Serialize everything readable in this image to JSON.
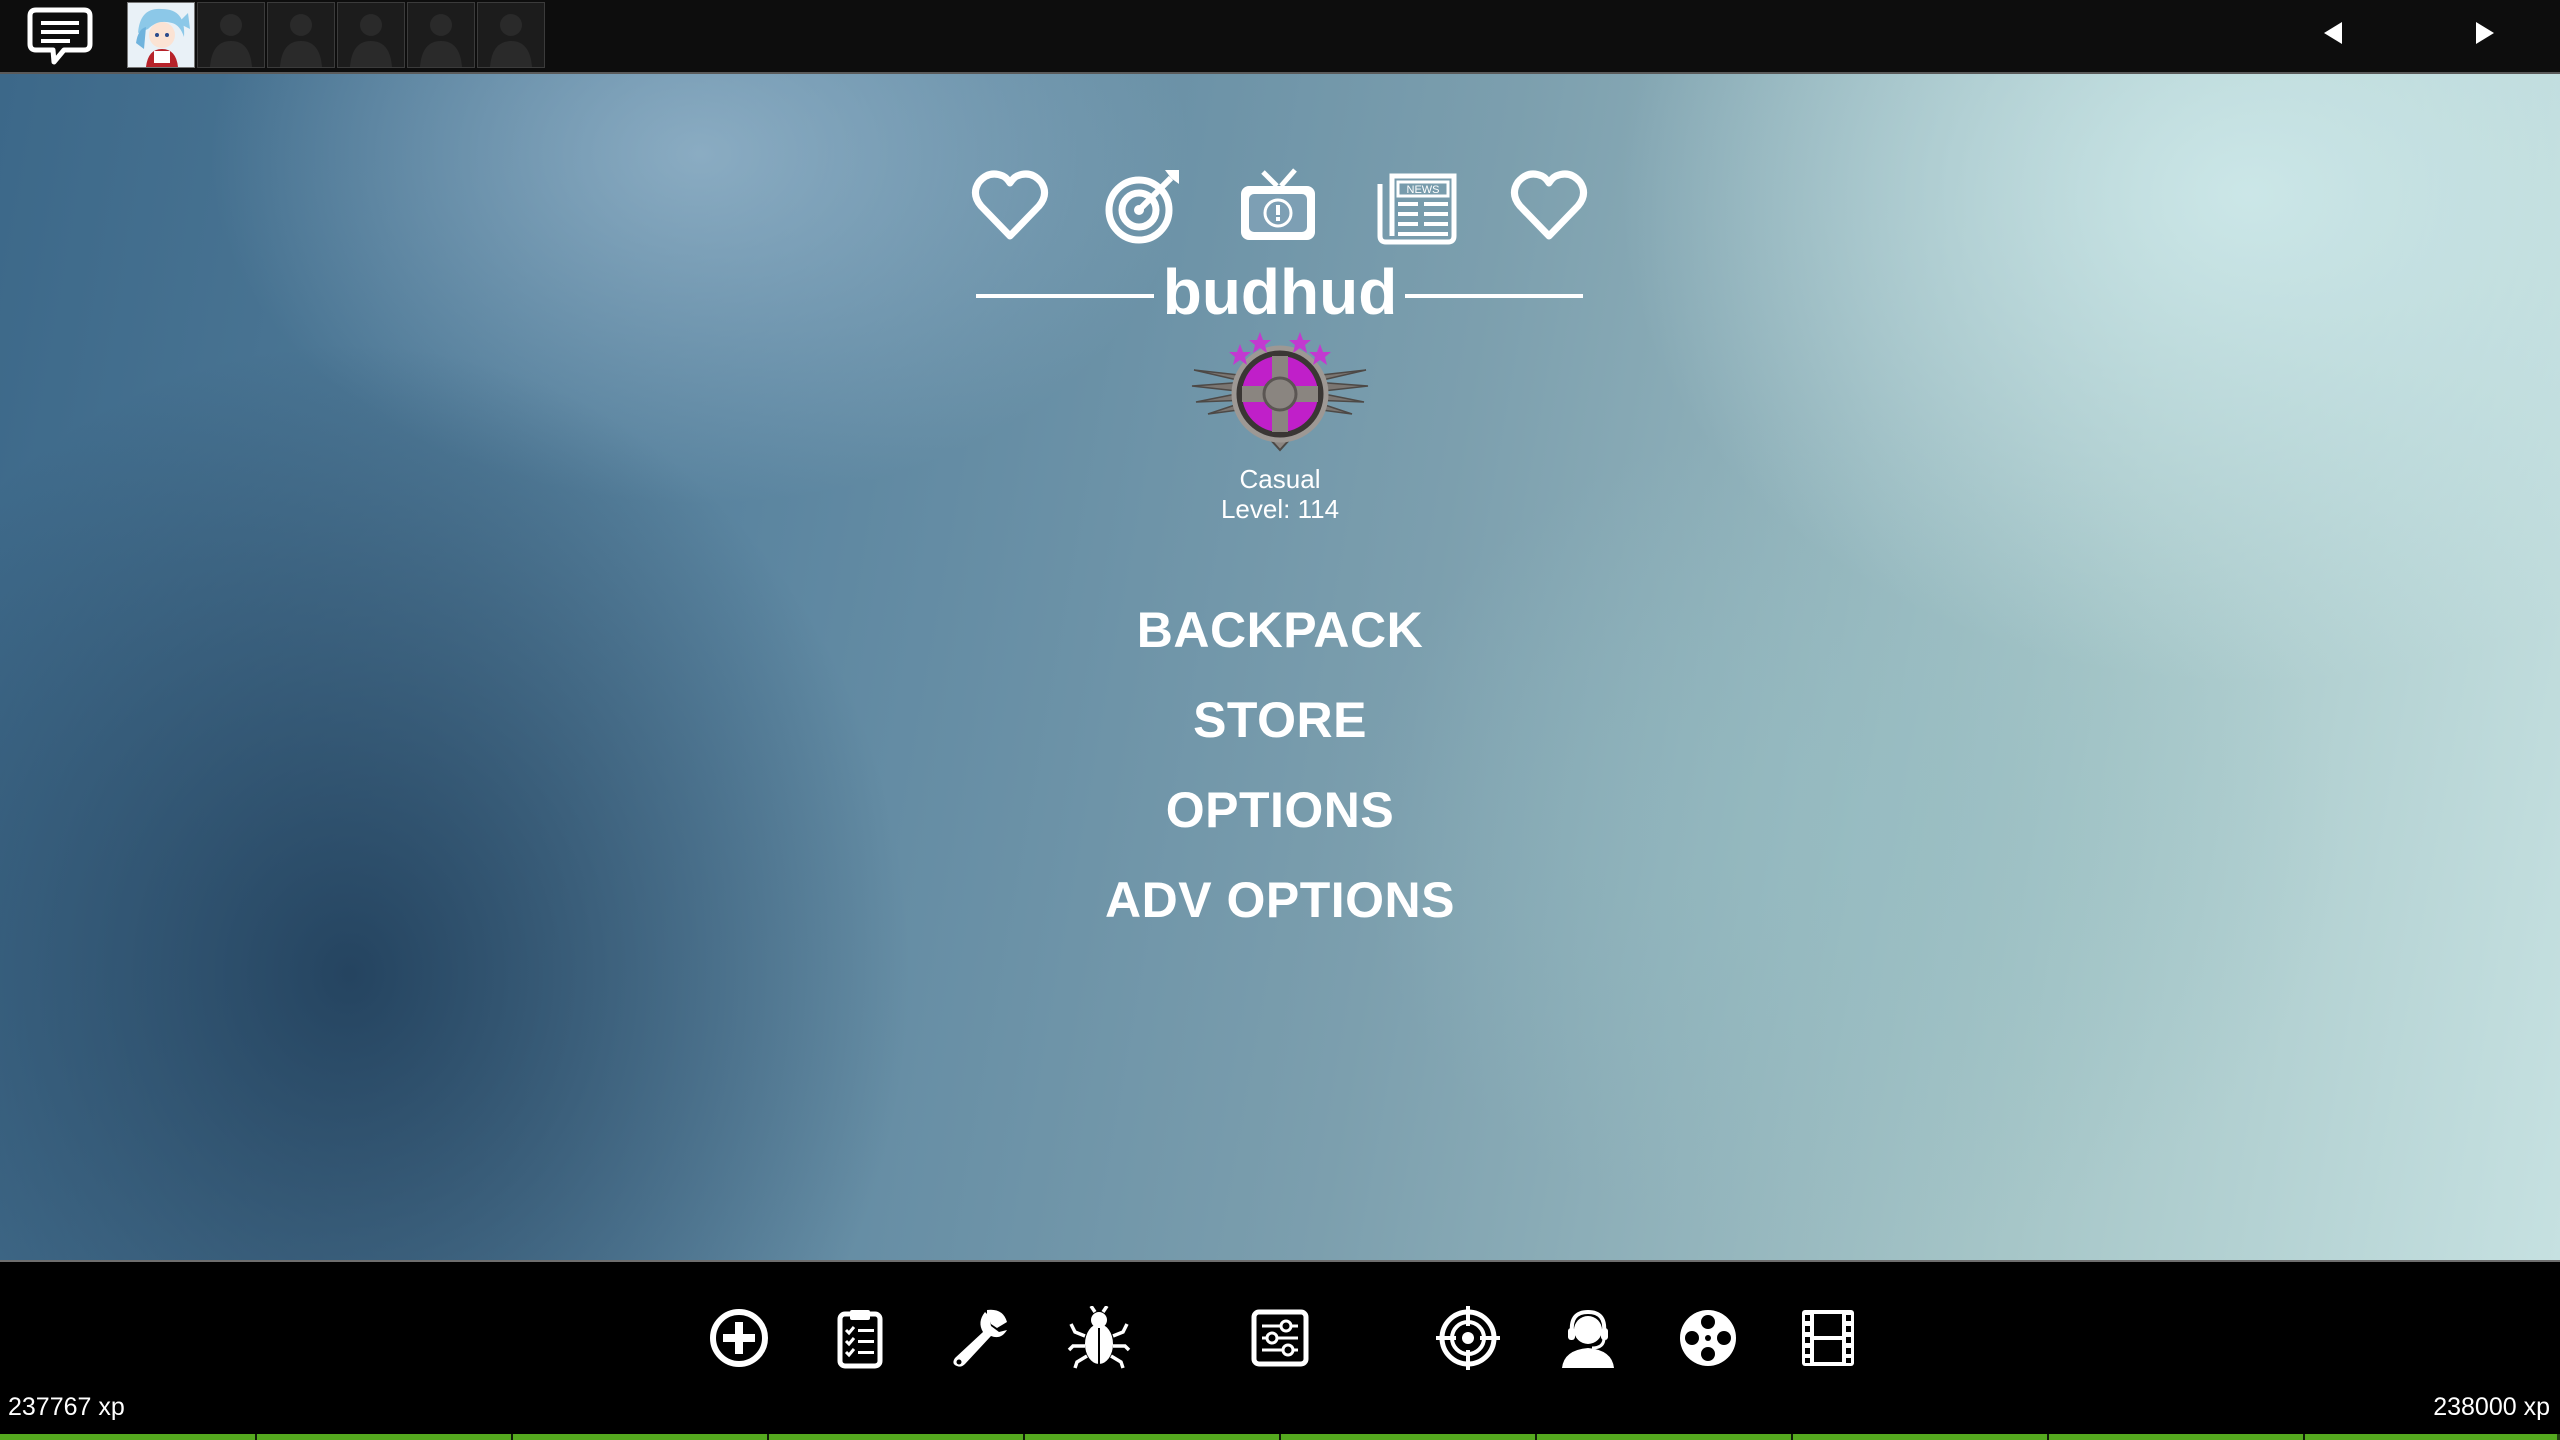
{
  "player": {
    "name": "budhud",
    "mode": "Casual",
    "level_text": "Level: 114"
  },
  "menu": {
    "items": [
      "BACKPACK",
      "STORE",
      "OPTIONS",
      "ADV OPTIONS"
    ]
  },
  "top_icons": [
    "heart-icon",
    "target-icon",
    "tv-alert-icon",
    "news-icon",
    "heart-icon"
  ],
  "bottom_icons": [
    "create-server-icon",
    "quests-icon",
    "workshop-icon",
    "report-bug-icon",
    "settings-sliders-icon",
    "training-icon",
    "support-icon",
    "replay-icon",
    "movie-icon"
  ],
  "party": {
    "slot_count": 6,
    "filled_slots": 1
  },
  "xp": {
    "current": "237767 xp",
    "next": "238000 xp",
    "progress": 0.999
  },
  "colors": {
    "badge_accent": "#c01fc9",
    "star": "#c23ad0",
    "xp_bar": "#55a91f"
  }
}
